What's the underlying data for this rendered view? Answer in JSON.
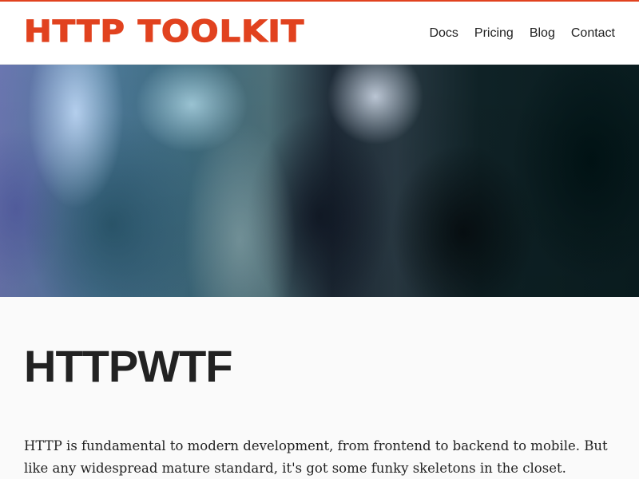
{
  "header": {
    "logo": "HTTP TOOLKIT",
    "nav": [
      "Docs",
      "Pricing",
      "Blog",
      "Contact"
    ]
  },
  "hero": {
    "image": "blurred-abstract-hero-image"
  },
  "main": {
    "title": "HTTPWTF",
    "intro": "HTTP is fundamental to modern development, from frontend to backend to mobile. But like any widespread mature standard, it's got some funky skeletons in the closet."
  },
  "colors": {
    "brand": "#e1421f",
    "text": "#222222",
    "background": "#fafafa"
  }
}
